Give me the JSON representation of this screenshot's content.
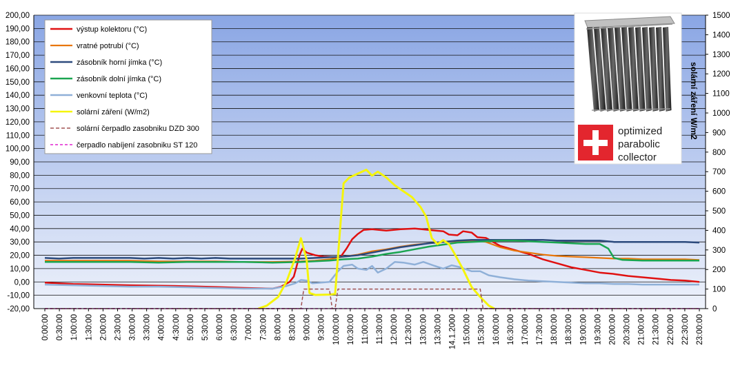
{
  "chart_data": {
    "type": "line",
    "y2label": "solární záření W/m2",
    "ylim": [
      -20,
      200
    ],
    "y2lim": [
      0,
      1500
    ],
    "y_ticks": [
      "200,00",
      "190,00",
      "180,00",
      "170,00",
      "160,00",
      "150,00",
      "140,00",
      "130,00",
      "120,00",
      "110,00",
      "100,00",
      "90,00",
      "80,00",
      "70,00",
      "60,00",
      "50,00",
      "40,00",
      "30,00",
      "20,00",
      "10,00",
      "0,00",
      "-10,00",
      "-20,00"
    ],
    "y2_ticks": [
      "1500",
      "1400",
      "1300",
      "1200",
      "1100",
      "1000",
      "900",
      "800",
      "700",
      "600",
      "500",
      "400",
      "300",
      "200",
      "100",
      "0"
    ],
    "x_tick_labels": [
      "0:00:00",
      "0:30:00",
      "1:00:00",
      "1:30:00",
      "2:00:00",
      "2:30:00",
      "3:00:00",
      "3:30:00",
      "4:00:00",
      "4:30:00",
      "5:00:00",
      "5:30:00",
      "6:00:00",
      "6:30:00",
      "7:00:00",
      "7:30:00",
      "8:00:00",
      "8:30:00",
      "9:00:00",
      "9:30:00",
      "10:00:00",
      "10:30:00",
      "11:00:00",
      "11:30:00",
      "12:00:00",
      "12:30:00",
      "13:00:00",
      "13:30:00",
      "14.1.2000",
      "15:00:00",
      "15:30:00",
      "16:00:00",
      "16:30:00",
      "17:00:00",
      "17:30:00",
      "18:00:00",
      "18:30:00",
      "19:00:00",
      "19:30:00",
      "20:00:00",
      "20:30:00",
      "21:00:00",
      "21:30:00",
      "22:00:00",
      "22:30:00",
      "23:00:00"
    ],
    "x_hours_range": [
      0,
      23
    ],
    "grid": true,
    "legend_position": "top-left",
    "series": [
      {
        "name": "výstup kolektoru (°C)",
        "color": "#e01010",
        "axis": "left",
        "width": 2.5,
        "dash": "",
        "points": [
          [
            0,
            -0.5
          ],
          [
            0.5,
            -1
          ],
          [
            1,
            -1.5
          ],
          [
            2,
            -2
          ],
          [
            3,
            -2.5
          ],
          [
            4,
            -2.8
          ],
          [
            5,
            -3.2
          ],
          [
            6,
            -3.8
          ],
          [
            7,
            -4.5
          ],
          [
            8,
            -5
          ],
          [
            8.3,
            -3.5
          ],
          [
            8.6,
            0
          ],
          [
            8.75,
            4
          ],
          [
            8.85,
            12
          ],
          [
            8.95,
            20
          ],
          [
            9.05,
            25
          ],
          [
            9.2,
            22
          ],
          [
            9.5,
            20
          ],
          [
            9.8,
            19
          ],
          [
            10.2,
            18.5
          ],
          [
            10.4,
            19
          ],
          [
            10.6,
            25
          ],
          [
            10.8,
            32
          ],
          [
            11,
            36
          ],
          [
            11.2,
            39
          ],
          [
            11.5,
            39.5
          ],
          [
            12,
            38.5
          ],
          [
            12.5,
            39.5
          ],
          [
            13,
            40
          ],
          [
            13.5,
            39
          ],
          [
            14,
            38
          ],
          [
            14.2,
            35.5
          ],
          [
            14.5,
            35
          ],
          [
            14.7,
            38
          ],
          [
            15,
            37
          ],
          [
            15.2,
            33.5
          ],
          [
            15.5,
            33
          ],
          [
            16,
            27
          ],
          [
            16.5,
            24
          ],
          [
            17,
            21
          ],
          [
            17.5,
            17
          ],
          [
            18,
            14
          ],
          [
            18.5,
            11
          ],
          [
            19,
            9
          ],
          [
            19.5,
            7
          ],
          [
            20,
            6
          ],
          [
            20.5,
            4.5
          ],
          [
            21,
            3.5
          ],
          [
            21.5,
            2.5
          ],
          [
            22,
            1.5
          ],
          [
            22.5,
            1
          ],
          [
            23,
            0
          ]
        ]
      },
      {
        "name": "vratné potrubí (°C)",
        "color": "#e8760a",
        "axis": "left",
        "width": 2.2,
        "dash": "",
        "points": [
          [
            0,
            16
          ],
          [
            1,
            16
          ],
          [
            2,
            16
          ],
          [
            3,
            16
          ],
          [
            4,
            15.5
          ],
          [
            5,
            15.5
          ],
          [
            6,
            15.5
          ],
          [
            7,
            15
          ],
          [
            8,
            15
          ],
          [
            9,
            15.5
          ],
          [
            9.5,
            16
          ],
          [
            10,
            17
          ],
          [
            10.5,
            19
          ],
          [
            11,
            20.5
          ],
          [
            11.5,
            23
          ],
          [
            12,
            24.5
          ],
          [
            12.5,
            26.5
          ],
          [
            13,
            28
          ],
          [
            13.5,
            29
          ],
          [
            14,
            30
          ],
          [
            14.5,
            30.5
          ],
          [
            15,
            31
          ],
          [
            15.5,
            30
          ],
          [
            16,
            26
          ],
          [
            16.5,
            23.5
          ],
          [
            17,
            22
          ],
          [
            17.5,
            20.5
          ],
          [
            18,
            19.5
          ],
          [
            18.5,
            19
          ],
          [
            19,
            18.5
          ],
          [
            19.5,
            18
          ],
          [
            20,
            17.5
          ],
          [
            20.5,
            17.5
          ],
          [
            21,
            17
          ],
          [
            21.5,
            17
          ],
          [
            22,
            17
          ],
          [
            22.5,
            17
          ],
          [
            23,
            16.5
          ]
        ]
      },
      {
        "name": "zásobník horní jímka (°C)",
        "color": "#2c4a7c",
        "axis": "left",
        "width": 2.5,
        "dash": "",
        "points": [
          [
            0,
            18
          ],
          [
            0.5,
            17.5
          ],
          [
            1,
            18
          ],
          [
            2,
            18
          ],
          [
            3,
            18
          ],
          [
            3.5,
            17.5
          ],
          [
            4,
            18
          ],
          [
            4.5,
            17.5
          ],
          [
            5,
            18
          ],
          [
            5.5,
            17.5
          ],
          [
            6,
            18
          ],
          [
            6.5,
            17.5
          ],
          [
            7,
            17.5
          ],
          [
            8,
            17.5
          ],
          [
            8.5,
            17.5
          ],
          [
            9,
            17.5
          ],
          [
            9.5,
            18
          ],
          [
            10,
            18.5
          ],
          [
            10.5,
            19
          ],
          [
            11,
            20
          ],
          [
            11.5,
            22
          ],
          [
            12,
            24
          ],
          [
            12.5,
            26
          ],
          [
            13,
            27.5
          ],
          [
            13.5,
            29
          ],
          [
            14,
            30
          ],
          [
            14.5,
            31
          ],
          [
            15,
            31.5
          ],
          [
            16,
            31.5
          ],
          [
            17,
            31.5
          ],
          [
            17.5,
            31.5
          ],
          [
            18,
            31
          ],
          [
            19,
            31
          ],
          [
            19.5,
            31
          ],
          [
            20,
            30
          ],
          [
            21,
            30
          ],
          [
            22,
            30
          ],
          [
            22.5,
            30
          ],
          [
            23,
            29.5
          ]
        ]
      },
      {
        "name": "zásobník dolní jímka  (°C)",
        "color": "#1aa550",
        "axis": "left",
        "width": 2.5,
        "dash": "",
        "points": [
          [
            0,
            15
          ],
          [
            1,
            15
          ],
          [
            2,
            15
          ],
          [
            3,
            15
          ],
          [
            4,
            14.5
          ],
          [
            5,
            15
          ],
          [
            6,
            15
          ],
          [
            7,
            15
          ],
          [
            8,
            14.5
          ],
          [
            9,
            15
          ],
          [
            9.5,
            15.5
          ],
          [
            10,
            16
          ],
          [
            10.5,
            17
          ],
          [
            11,
            17.5
          ],
          [
            11.5,
            19
          ],
          [
            12,
            21
          ],
          [
            12.5,
            22.5
          ],
          [
            13,
            24.5
          ],
          [
            13.5,
            26.5
          ],
          [
            14,
            28
          ],
          [
            14.5,
            29.5
          ],
          [
            15,
            30
          ],
          [
            15.5,
            30.5
          ],
          [
            16,
            31
          ],
          [
            16.5,
            31
          ],
          [
            17,
            30.5
          ],
          [
            17.5,
            30
          ],
          [
            18,
            29.5
          ],
          [
            18.5,
            29
          ],
          [
            19,
            28.5
          ],
          [
            19.5,
            28.5
          ],
          [
            19.8,
            25
          ],
          [
            20,
            18
          ],
          [
            20.3,
            16.5
          ],
          [
            21,
            16
          ],
          [
            22,
            16
          ],
          [
            23,
            16
          ]
        ]
      },
      {
        "name": "venkovní teplota (°C)",
        "color": "#8fb0d8",
        "axis": "left",
        "width": 2.5,
        "dash": "",
        "points": [
          [
            0,
            -2
          ],
          [
            1,
            -2.5
          ],
          [
            2,
            -3
          ],
          [
            3,
            -3.5
          ],
          [
            4,
            -3.5
          ],
          [
            5,
            -4
          ],
          [
            6,
            -4.5
          ],
          [
            7,
            -5
          ],
          [
            8,
            -5
          ],
          [
            8.5,
            -3
          ],
          [
            8.8,
            -1
          ],
          [
            9,
            1.5
          ],
          [
            9.2,
            1
          ],
          [
            9.4,
            -1
          ],
          [
            9.7,
            -0.5
          ],
          [
            10,
            0
          ],
          [
            10.3,
            8
          ],
          [
            10.5,
            12
          ],
          [
            10.8,
            13
          ],
          [
            11,
            10
          ],
          [
            11.3,
            9
          ],
          [
            11.5,
            12
          ],
          [
            11.7,
            7
          ],
          [
            12,
            10
          ],
          [
            12.3,
            15
          ],
          [
            12.6,
            14.5
          ],
          [
            13,
            13
          ],
          [
            13.3,
            15
          ],
          [
            13.7,
            12
          ],
          [
            14,
            10
          ],
          [
            14.3,
            12.5
          ],
          [
            14.6,
            11
          ],
          [
            15,
            8
          ],
          [
            15.3,
            8
          ],
          [
            15.6,
            5
          ],
          [
            16,
            3.5
          ],
          [
            16.5,
            2
          ],
          [
            17,
            1
          ],
          [
            17.5,
            0.5
          ],
          [
            18,
            0
          ],
          [
            18.5,
            -0.5
          ],
          [
            19,
            -1
          ],
          [
            19.5,
            -1
          ],
          [
            20,
            -1.5
          ],
          [
            20.5,
            -1.5
          ],
          [
            21,
            -2
          ],
          [
            21.5,
            -2
          ],
          [
            22,
            -2
          ],
          [
            22.5,
            -2
          ],
          [
            23,
            -2
          ]
        ]
      },
      {
        "name": "solární záření (W/m2)",
        "color": "#f5f50a",
        "axis": "right",
        "width": 3,
        "dash": "",
        "points": [
          [
            7.5,
            0
          ],
          [
            7.8,
            15
          ],
          [
            8.2,
            60
          ],
          [
            8.5,
            140
          ],
          [
            8.8,
            260
          ],
          [
            9.0,
            360
          ],
          [
            9.2,
            250
          ],
          [
            9.3,
            80
          ],
          [
            9.5,
            70
          ],
          [
            10.0,
            72
          ],
          [
            10.2,
            75
          ],
          [
            10.5,
            640
          ],
          [
            10.7,
            670
          ],
          [
            11.0,
            690
          ],
          [
            11.3,
            710
          ],
          [
            11.5,
            680
          ],
          [
            11.7,
            700
          ],
          [
            12.0,
            670
          ],
          [
            12.3,
            630
          ],
          [
            12.6,
            600
          ],
          [
            12.9,
            570
          ],
          [
            13.2,
            520
          ],
          [
            13.4,
            470
          ],
          [
            13.6,
            360
          ],
          [
            13.8,
            330
          ],
          [
            14.0,
            350
          ],
          [
            14.2,
            330
          ],
          [
            14.4,
            280
          ],
          [
            14.7,
            200
          ],
          [
            15.0,
            110
          ],
          [
            15.3,
            60
          ],
          [
            15.6,
            15
          ],
          [
            15.8,
            0
          ]
        ]
      },
      {
        "name": "solární čerpadlo zasobniku  DZD 300",
        "color": "#a05050",
        "axis": "right",
        "width": 1.5,
        "dash": "5 3",
        "points": [
          [
            0,
            0
          ],
          [
            9.0,
            0
          ],
          [
            9.1,
            100
          ],
          [
            10.0,
            100
          ],
          [
            10.1,
            0
          ],
          [
            10.2,
            0
          ],
          [
            10.3,
            100
          ],
          [
            15.3,
            100
          ],
          [
            15.4,
            0
          ],
          [
            23,
            0
          ]
        ]
      },
      {
        "name": "čerpadlo nabíjení  zasobniku ST 120",
        "color": "#e020d0",
        "axis": "right",
        "width": 1.5,
        "dash": "4 3",
        "points": [
          [
            0,
            0
          ],
          [
            23,
            0
          ]
        ]
      }
    ]
  },
  "logo": {
    "brand_line1": "optimized",
    "brand_line2": "parabolic",
    "brand_line3": "collector"
  }
}
